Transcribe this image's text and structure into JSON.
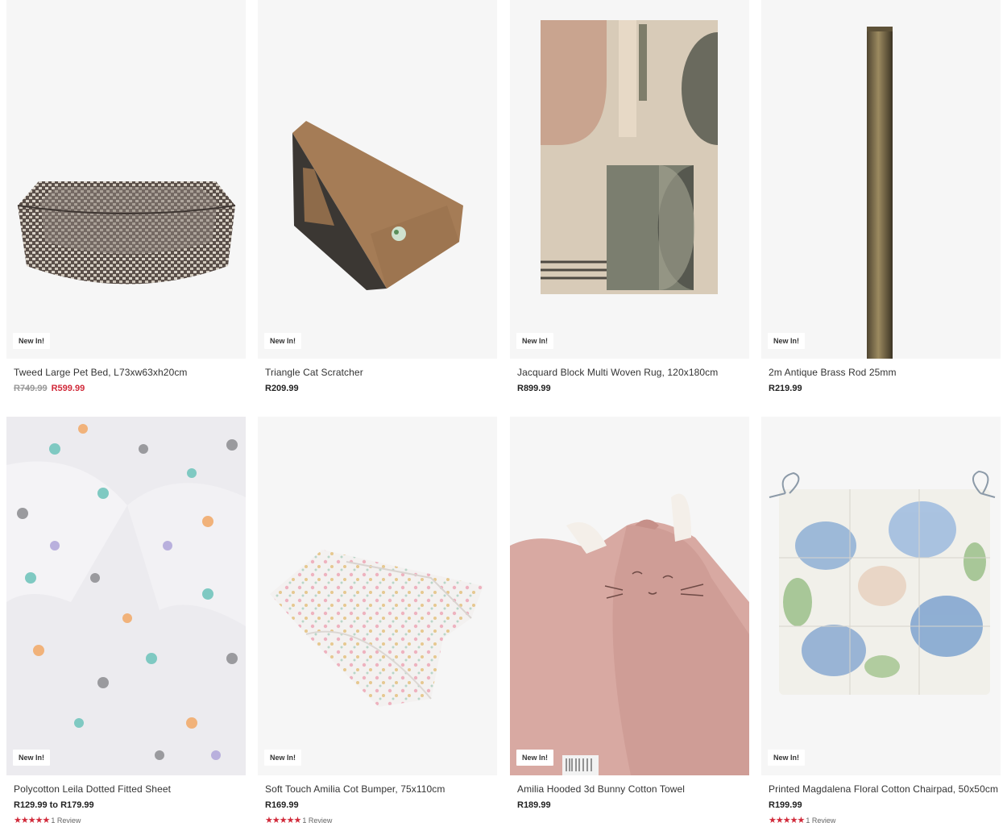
{
  "products": [
    {
      "name": "Tweed Large Pet Bed, L73xw63xh20cm",
      "badge": "New In!",
      "was_price": "R749.99",
      "price": "R599.99"
    },
    {
      "name": "Triangle Cat Scratcher",
      "badge": "New In!",
      "price": "R209.99"
    },
    {
      "name": "Jacquard Block Multi Woven Rug, 120x180cm",
      "badge": "New In!",
      "price": "R899.99"
    },
    {
      "name": "2m Antique Brass Rod 25mm",
      "badge": "New In!",
      "price": "R219.99"
    },
    {
      "name": "Polycotton Leila Dotted Fitted Sheet",
      "badge": "New In!",
      "price": "R129.99 to R179.99",
      "stars": "★★★★★",
      "reviews": "1 Review"
    },
    {
      "name": "Soft Touch Amilia Cot Bumper, 75x110cm",
      "badge": "New In!",
      "price": "R169.99",
      "stars": "★★★★★",
      "reviews": "1 Review"
    },
    {
      "name": "Amilia Hooded 3d Bunny Cotton Towel",
      "badge": "New In!",
      "price": "R189.99"
    },
    {
      "name": "Printed Magdalena Floral Cotton Chairpad, 50x50cm",
      "badge": "New In!",
      "price": "R199.99",
      "stars": "★★★★★",
      "reviews": "1 Review"
    }
  ],
  "colors": {
    "sale": "#d12a3a",
    "stars": "#d12a3a",
    "image_bg": "#f6f6f6"
  }
}
